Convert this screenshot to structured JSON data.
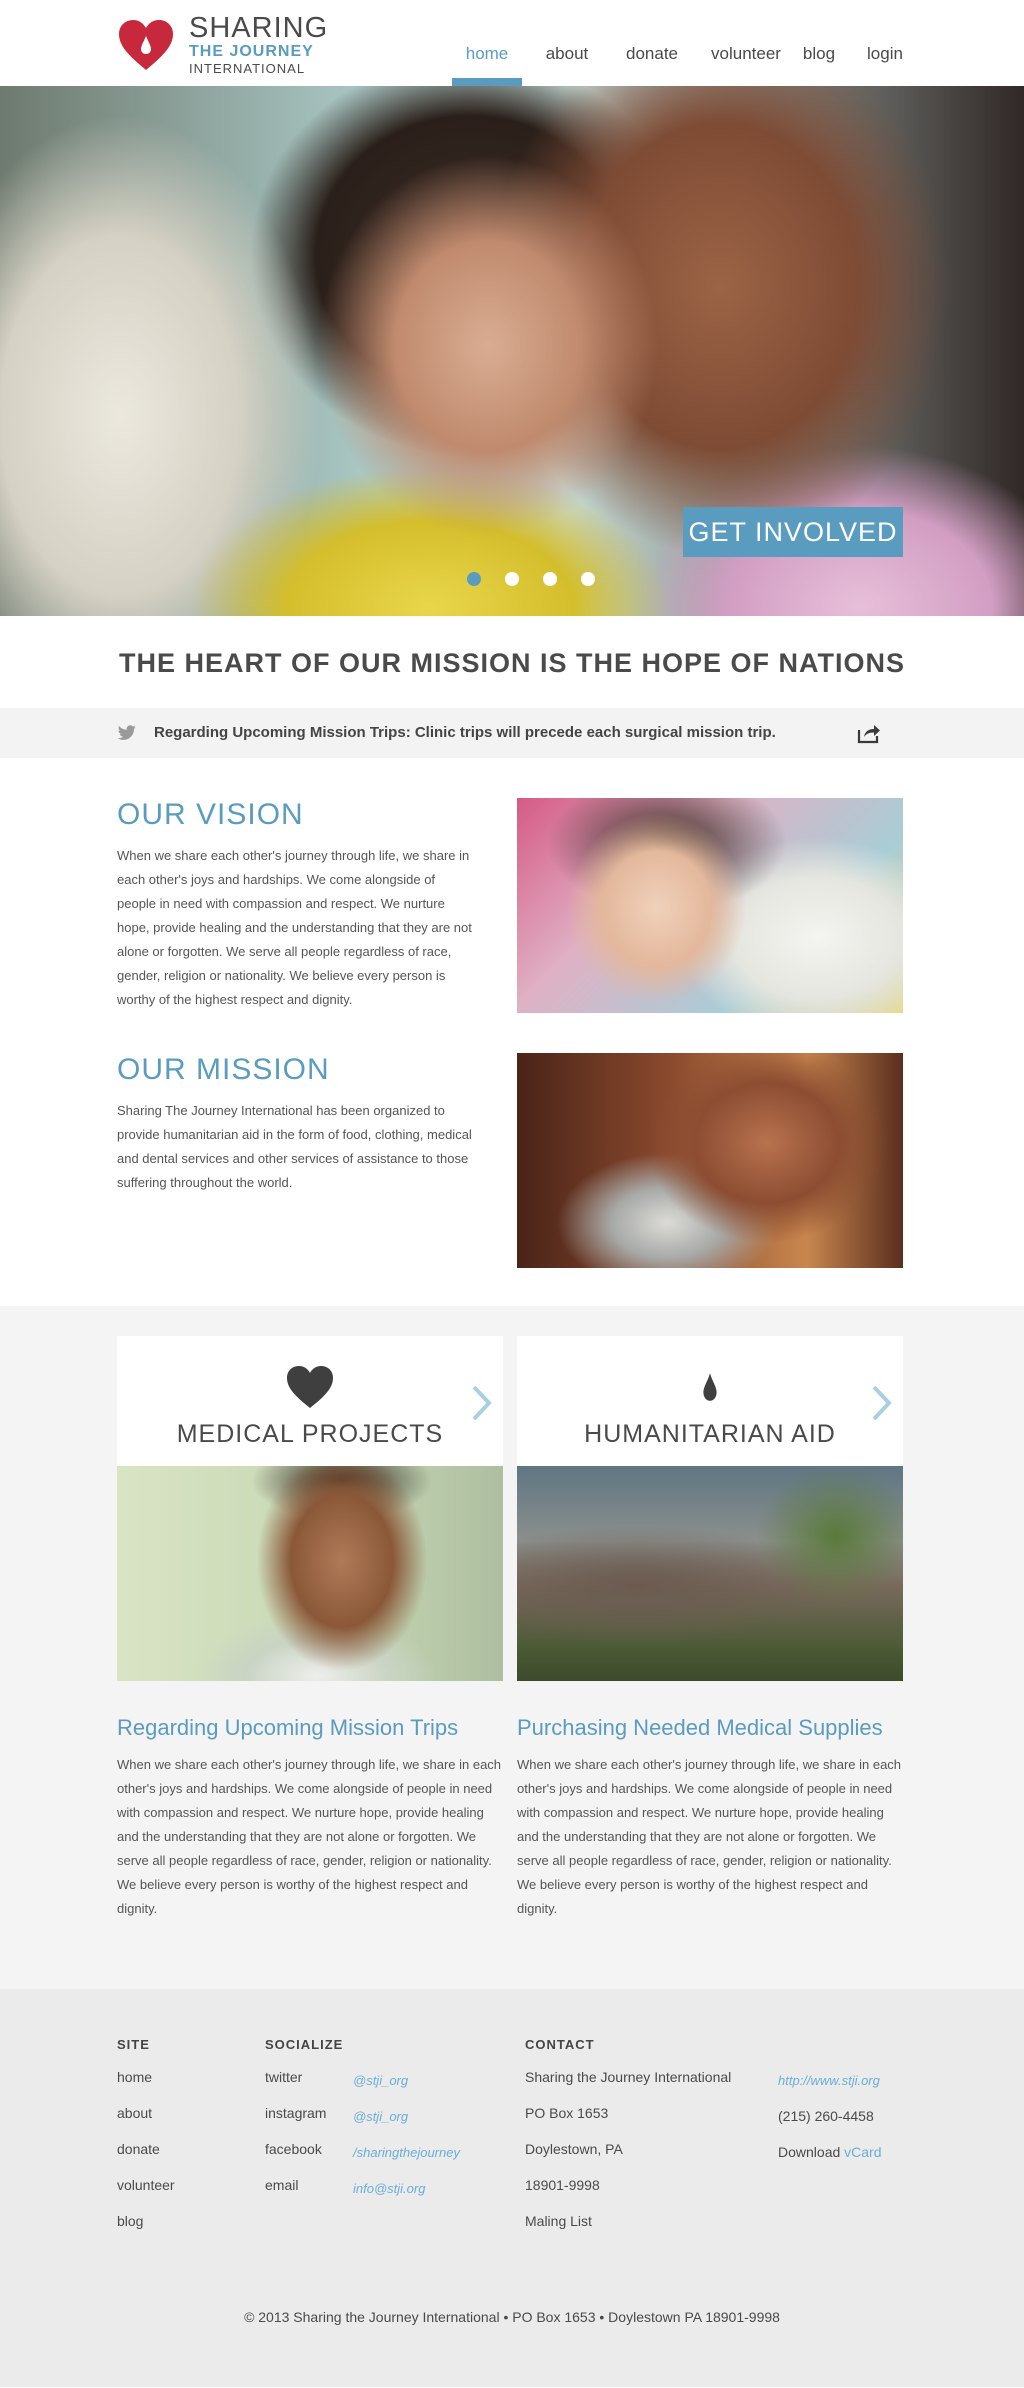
{
  "logo": {
    "line1": "SHARING",
    "line2": "THE JOURNEY",
    "line3": "INTERNATIONAL"
  },
  "nav": [
    {
      "label": "home",
      "active": true
    },
    {
      "label": "about"
    },
    {
      "label": "donate"
    },
    {
      "label": "volunteer"
    },
    {
      "label": "blog"
    },
    {
      "label": "login"
    }
  ],
  "hero": {
    "cta": "GET INVOLVED",
    "slide_count": 4,
    "active_slide": 1
  },
  "tagline": "THE HEART OF OUR MISSION IS THE HOPE OF NATIONS",
  "ticker": {
    "text": "Regarding Upcoming Mission Trips: Clinic trips will precede each surgical mission trip."
  },
  "vision": {
    "title": "OUR VISION",
    "body": "When we share each other's journey through life, we share in each other's joys and hardships.  We come alongside of people in need with compassion and respect. We nurture hope, provide healing and the understanding that they are not alone or forgotten. We serve all people regardless of race, gender, religion or nationality. We believe every person is worthy of the highest respect and dignity."
  },
  "mission": {
    "title": "OUR MISSION",
    "body": "Sharing The Journey International has been organized to provide humanitarian aid in the form of food, clothing, medical and dental services and other services of assistance to those suffering throughout the world."
  },
  "cards": [
    {
      "title": "MEDICAL PROJECTS",
      "icon": "heart-icon"
    },
    {
      "title": "HUMANITARIAN AID",
      "icon": "drop-icon"
    }
  ],
  "posts": [
    {
      "title": "Regarding Upcoming Mission Trips",
      "body": "When we share each other's journey through life, we share in each other's joys and hardships.  We come alongside of people in need with compassion and respect. We nurture hope, provide healing and the understanding that they are not alone or forgotten. We serve all people regardless of race, gender, religion or nationality. We believe every person is worthy of the highest respect and dignity."
    },
    {
      "title": "Purchasing Needed Medical Supplies",
      "body": "When we share each other's journey through life, we share in each other's joys and hardships.  We come alongside of people in need with compassion and respect. We nurture hope, provide healing and the understanding that they are not alone or forgotten. We serve all people regardless of race, gender, religion or nationality. We believe every person is worthy of the highest respect and dignity."
    }
  ],
  "footer": {
    "site": {
      "heading": "SITE",
      "links": [
        "home",
        "about",
        "donate",
        "volunteer",
        "blog"
      ]
    },
    "socialize": {
      "heading": "SOCIALIZE",
      "items": [
        {
          "label": "twitter",
          "handle": "@stji_org"
        },
        {
          "label": "instagram",
          "handle": "@stji_org"
        },
        {
          "label": "facebook",
          "handle": "/sharingthejourney"
        },
        {
          "label": "email",
          "handle": "info@stji.org"
        }
      ]
    },
    "contact": {
      "heading": "CONTACT",
      "left": [
        "Sharing the Journey International",
        "PO Box 1653",
        "Doylestown, PA",
        "18901-9998",
        "Maling List"
      ],
      "url": "http://www.stji.org",
      "phone": "(215) 260-4458",
      "download_prefix": "Download",
      "download_link": "vCard"
    },
    "copyright": "© 2013 Sharing the Journey International • PO Box 1653 • Doylestown PA 18901-9998"
  },
  "colors": {
    "accent": "#5a9cbf",
    "logo_red": "#c8283c",
    "text": "#4a4a4a"
  }
}
